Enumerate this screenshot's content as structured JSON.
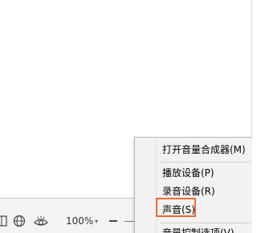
{
  "statusbar": {
    "zoom_label": "100%",
    "icons": [
      "view-mode-icon",
      "globe-icon",
      "eye-icon",
      "zoom-dropdown-icon",
      "zoom-out-icon",
      "zoom-slider-icon"
    ]
  },
  "context_menu": {
    "items": [
      {
        "label": "打开音量合成器(M)"
      },
      {
        "label": "播放设备(P)"
      },
      {
        "label": "录音设备(R)"
      },
      {
        "label": "声音(S)",
        "highlighted": true
      },
      {
        "label": "音量控制选项(V)"
      }
    ],
    "highlight_color": "#ee6a30"
  }
}
